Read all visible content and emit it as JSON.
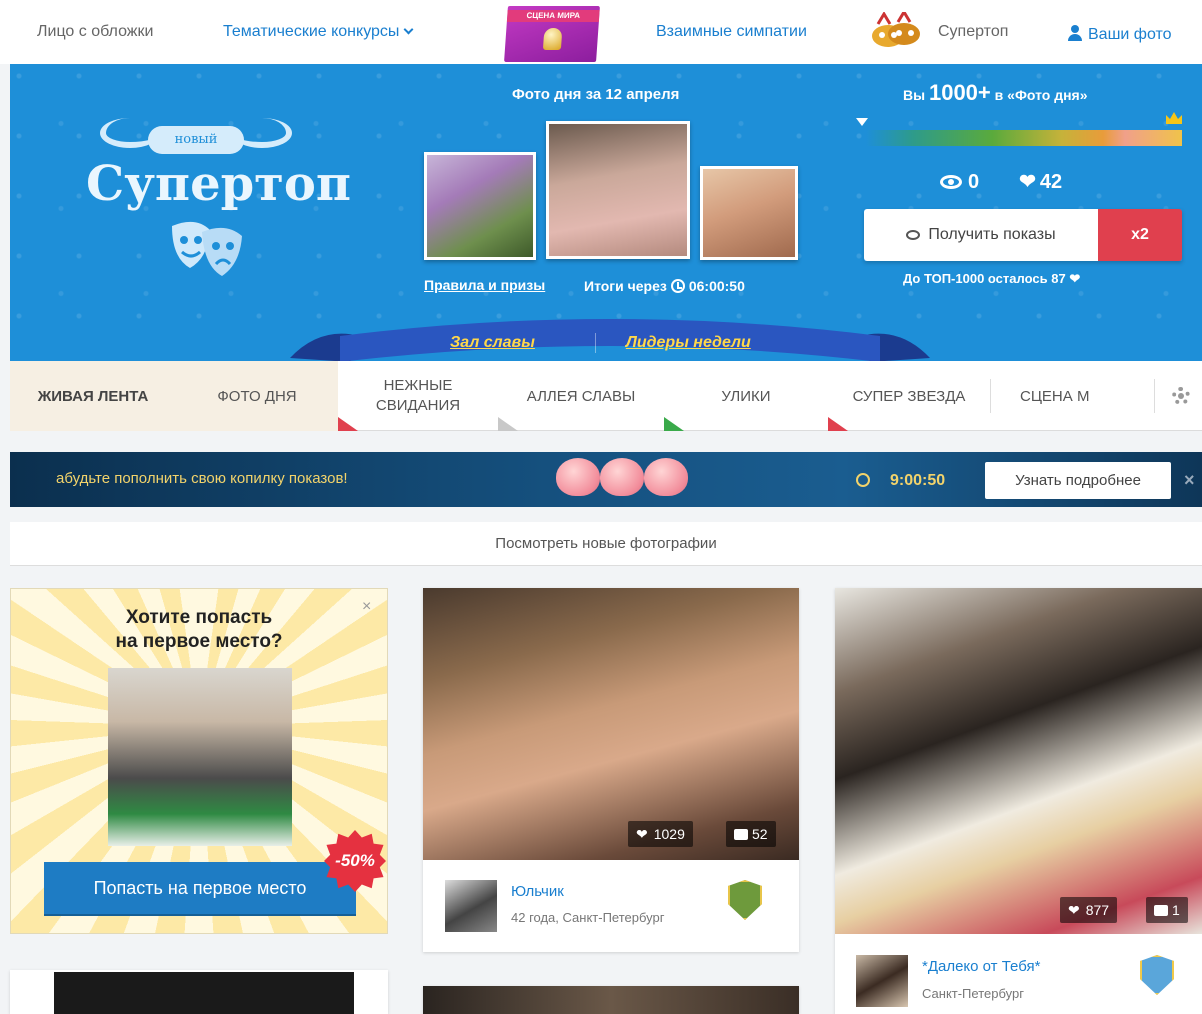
{
  "topnav": {
    "cover_face": "Лицо с обложки",
    "thematic": "Тематические конкурсы",
    "promo_band": "СЦЕНА МИРА",
    "mutual": "Взаимные симпатии",
    "supertop": "Супертоп",
    "your_photos": "Ваши фото"
  },
  "banner": {
    "logo_new": "новый",
    "logo_text": "Супертоп",
    "photo_day_title": "Фото дня за 12 апреля",
    "rules_link": "Правила и призы",
    "results_label": "Итоги через",
    "results_time": "06:00:50",
    "rank_prefix": "Вы",
    "rank_value": "1000+",
    "rank_suffix": "в «Фото дня»",
    "views": "0",
    "likes": "42",
    "get_views": "Получить показы",
    "multiplier": "x2",
    "top_remaining": "До ТОП-1000 осталось",
    "top_remaining_count": "87",
    "hall_of_fame": "Зал славы",
    "leaders": "Лидеры недели"
  },
  "tabs": {
    "live_feed": "ЖИВАЯ ЛЕНТА",
    "photo_day": "ФОТО ДНЯ",
    "tender_dates_1": "НЕЖНЫЕ",
    "tender_dates_2": "СВИДАНИЯ",
    "alley": "АЛЛЕЯ СЛАВЫ",
    "evidence": "УЛИКИ",
    "superstar": "СУПЕР ЗВЕЗДА",
    "stage": "СЦЕНА М"
  },
  "piggy": {
    "text": "абудьте пополнить свою копилку показов!",
    "timer": "9:00:50",
    "learn_more": "Узнать подробнее",
    "close": "×"
  },
  "new_photos": "Посмотреть новые фотографии",
  "promo": {
    "title_1": "Хотите попасть",
    "title_2": "на первое место?",
    "close": "×",
    "button": "Попасть на первое место",
    "discount": "-50%"
  },
  "cards": [
    {
      "likes": "1029",
      "comments": "52",
      "name": "Юльчик",
      "info": "42 года, Санкт-Петербург"
    },
    {
      "likes": "877",
      "comments": "1",
      "name": "*Далеко от Тебя*",
      "info": "Санкт-Петербург"
    }
  ],
  "colors": {
    "accent_blue": "#1a7fcf",
    "banner_blue": "#1e8fd8",
    "red": "#e0404e",
    "gold": "#ffd84a"
  }
}
